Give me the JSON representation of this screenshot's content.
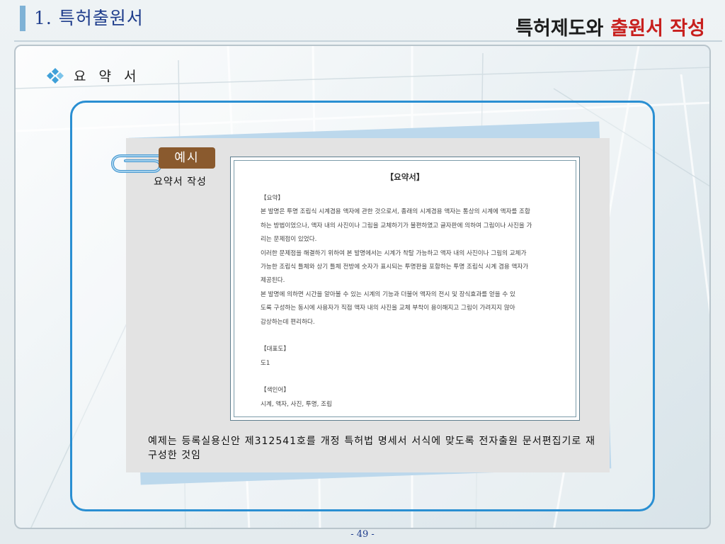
{
  "header": {
    "title": "1. 특허출원서",
    "brand_part1": "특허제도와",
    "brand_part2": "출원서 작성"
  },
  "section": {
    "title": "요 약 서",
    "bullet_icon": "diamond-cluster-icon"
  },
  "example": {
    "badge_label": "예시",
    "caption": "요약서 작성",
    "clip_icon": "paperclip-icon"
  },
  "document": {
    "title": "【요약서】",
    "lines": [
      "【요약】",
      "본 발명은 투명 조립식 시계겸용 액자에 관한 것으로서, 종래의 시계겸용 액자는 통상의 시계에 액자를 조합",
      "하는 방법이었으나, 액자 내의 사진이나 그림을 교체하기가 불편하였고 글자판에 의하여 그림이나 사진을 가",
      "리는 문제점이 있었다.",
      "이러한 문제점을 해결하기 위하여 본 발명에서는 시계가 착탈 가능하고 액자 내의 사진이나 그림의 교체가",
      "가능한 조립식 틀체와 상기 틀체 전방에 숫자가 표시되는 투명판을 포함하는 투명 조립식 시계 겸용 액자가",
      "제공된다.",
      "본 발명에 의하면 시간을 알아볼 수 있는 시계의 기능과 더불어 액자의 전시 및 장식효과를 얻을 수 있",
      "도록 구성하는 동시에 사용자가 직접 액자 내의 사진을 교체 부착이 용이해지고 그림이 가려지지 않아",
      "감상하는데 편리하다.",
      "",
      "【대표도】",
      "도1",
      "",
      "【색인어】",
      "시계, 액자, 사진, 투명, 조립"
    ]
  },
  "note": "예제는 등록실용신안 제312541호를 개정 특허법 명세서 서식에 맞도록 전자출원 문서편집기로 재구성한 것임",
  "page_number": "- 49 -",
  "colors": {
    "frame_blue": "#2a8fd2",
    "badge_brown": "#8a5a2e",
    "brand_red": "#c8201e",
    "title_navy": "#1f3d8c"
  }
}
